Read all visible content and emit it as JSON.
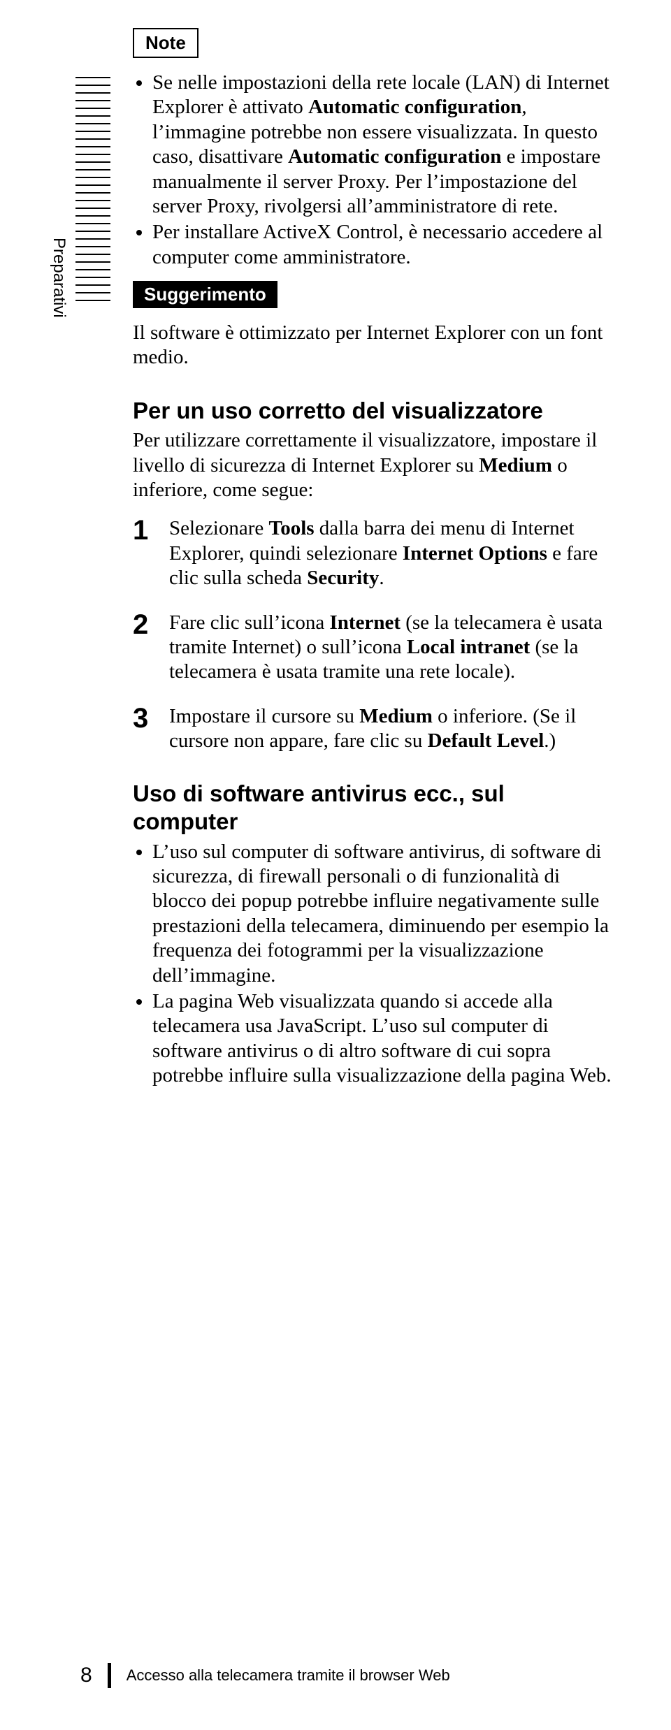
{
  "sidebar": {
    "section": "Preparativi"
  },
  "note": {
    "title": "Note",
    "items": [
      "Se nelle impostazioni della rete locale (LAN) di Internet Explorer è attivato <b>Automatic configuration</b>, l’immagine potrebbe non essere visualizzata. In questo caso, disattivare <b>Automatic configuration</b> e impostare manualmente il server Proxy. Per l’impostazione del server Proxy, rivolgersi all’amministratore di rete.",
      "Per installare ActiveX Control, è necessario accedere al computer come amministratore."
    ]
  },
  "tip": {
    "title": "Suggerimento",
    "body": "Il software è ottimizzato per Internet Explorer con un font medio."
  },
  "section1": {
    "heading": "Per un uso corretto del visualizzatore",
    "intro": "Per utilizzare correttamente il visualizzatore, impostare il livello di sicurezza di Internet Explorer su <b>Medium</b> o inferiore, come segue:",
    "steps": [
      "Selezionare <b>Tools</b> dalla barra dei menu di Internet Explorer, quindi selezionare <b>Internet Options</b> e fare clic sulla scheda <b>Security</b>.",
      "Fare clic sull’icona <b>Internet</b> (se la telecamera è usata tramite Internet) o sull’icona <b>Local intranet</b> (se la telecamera è usata tramite una rete locale).",
      "Impostare il cursore su <b>Medium</b> o inferiore. (Se il cursore non appare, fare clic su <b>Default Level</b>.)"
    ]
  },
  "section2": {
    "heading": "Uso di software antivirus ecc., sul computer",
    "items": [
      "L’uso sul computer di software antivirus, di software di sicurezza, di firewall personali o di funzionalità di blocco dei popup potrebbe influire negativamente sulle prestazioni della telecamera, diminuendo per esempio la frequenza dei fotogrammi per la visualizzazione dell’immagine.",
      "La pagina Web visualizzata quando si accede alla telecamera usa JavaScript. L’uso sul computer di software antivirus o di altro software di cui sopra potrebbe influire sulla visualizzazione della pagina Web."
    ]
  },
  "footer": {
    "page": "8",
    "title": "Accesso alla telecamera tramite il browser Web"
  }
}
